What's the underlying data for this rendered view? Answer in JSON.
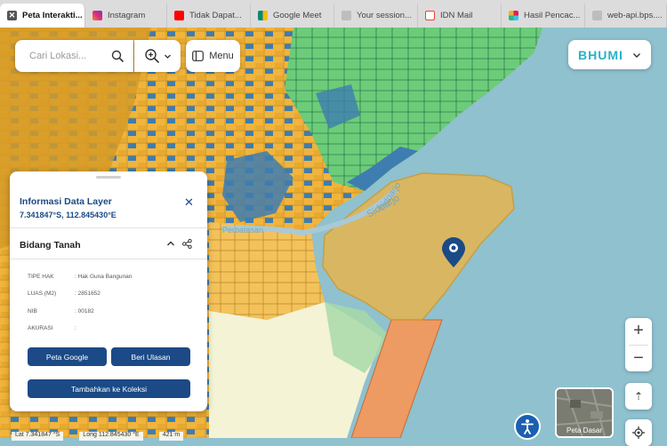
{
  "tabs": [
    {
      "label": "Peta Interakti...",
      "icon": "close-icon",
      "color": "#555555"
    },
    {
      "label": "Instagram",
      "icon": "instagram-icon",
      "color": "#d6249f"
    },
    {
      "label": "Tidak Dapat...",
      "icon": "youtube-icon",
      "color": "#ff0000"
    },
    {
      "label": "Google Meet",
      "icon": "google-meet-icon",
      "color": "#00897b"
    },
    {
      "label": "Your session...",
      "icon": "page-icon",
      "color": "#bdbdbd"
    },
    {
      "label": "IDN Mail",
      "icon": "gmail-icon",
      "color": "#ea4335"
    },
    {
      "label": "Hasil Pencac...",
      "icon": "slack-icon",
      "color": "#e01e5a"
    },
    {
      "label": "web-api.bps....",
      "icon": "page-icon",
      "color": "#bdbdbd"
    }
  ],
  "search": {
    "placeholder": "Cari Lokasi..."
  },
  "menu": {
    "label": "Menu"
  },
  "brand": {
    "logo_text": "BHUMI"
  },
  "map": {
    "colors": {
      "water": "#8fc1cf",
      "shm": "#3e7db0",
      "hgb": "#f1b43c",
      "hp": "#6ccc7a",
      "mixed": "#d69b27",
      "light": "#f4f3d6",
      "orange": "#ee9a63",
      "highlight": "#e6b550",
      "marker": "#1b4a86"
    },
    "river_label": "Sidoarjo",
    "river_label2": "Sidoarjo",
    "river_label3": "Perbatasan"
  },
  "panel": {
    "title": "Informasi Data Layer",
    "coordinates": "7.341847°S, 112.845430°E",
    "section": "Bidang Tanah",
    "attributes": [
      {
        "key": "TIPE HAK",
        "value": ": Hak Guna Bangunan"
      },
      {
        "key": "LUAS (M2)",
        "value": ": 2851652"
      },
      {
        "key": "NIB",
        "value": ": 00182"
      },
      {
        "key": "AKURASI",
        "value": ":"
      }
    ],
    "btn_google": "Peta Google",
    "btn_review": "Beri Ulasan",
    "btn_collection": "Tambahkan ke Koleksi"
  },
  "controls": {
    "zoom_in": "+",
    "zoom_out": "−",
    "compass": "⇡"
  },
  "basemap": {
    "label": "Peta Dasar"
  },
  "status": {
    "lat": "Lat 7.341847 °S",
    "lon": "Long 112.845430 °E",
    "scale": "421 m"
  }
}
